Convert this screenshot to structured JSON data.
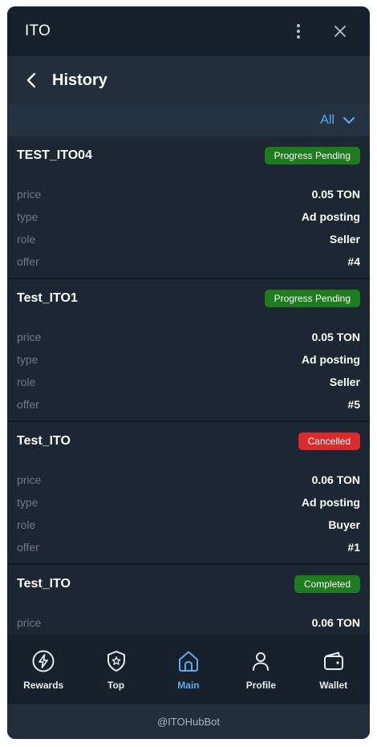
{
  "window": {
    "title": "ITO"
  },
  "header": {
    "title": "History"
  },
  "filter": {
    "label": "All"
  },
  "history": [
    {
      "name": "TEST_ITO04",
      "status": "Progress Pending",
      "status_kind": "pending",
      "fields": [
        {
          "key": "price",
          "value": "0.05 TON"
        },
        {
          "key": "type",
          "value": "Ad posting"
        },
        {
          "key": "role",
          "value": "Seller"
        },
        {
          "key": "offer",
          "value": "#4"
        }
      ]
    },
    {
      "name": "Test_ITO1",
      "status": "Progress Pending",
      "status_kind": "pending",
      "fields": [
        {
          "key": "price",
          "value": "0.05 TON"
        },
        {
          "key": "type",
          "value": "Ad posting"
        },
        {
          "key": "role",
          "value": "Seller"
        },
        {
          "key": "offer",
          "value": "#5"
        }
      ]
    },
    {
      "name": "Test_ITO",
      "status": "Cancelled",
      "status_kind": "cancelled",
      "fields": [
        {
          "key": "price",
          "value": "0.06 TON"
        },
        {
          "key": "type",
          "value": "Ad posting"
        },
        {
          "key": "role",
          "value": "Buyer"
        },
        {
          "key": "offer",
          "value": "#1"
        }
      ]
    },
    {
      "name": "Test_ITO",
      "status": "Completed",
      "status_kind": "completed",
      "fields": [
        {
          "key": "price",
          "value": "0.06 TON"
        }
      ]
    }
  ],
  "nav": [
    {
      "label": "Rewards",
      "icon": "lightning-icon",
      "active": false
    },
    {
      "label": "Top",
      "icon": "star-shield-icon",
      "active": false
    },
    {
      "label": "Main",
      "icon": "home-icon",
      "active": true
    },
    {
      "label": "Profile",
      "icon": "user-icon",
      "active": false
    },
    {
      "label": "Wallet",
      "icon": "wallet-icon",
      "active": false
    }
  ],
  "footer": {
    "bot": "@ITOHubBot"
  },
  "colors": {
    "accent": "#5eaaf0",
    "pending": "#1e7b1e",
    "cancelled": "#d92b2b",
    "completed": "#1e7b1e"
  }
}
